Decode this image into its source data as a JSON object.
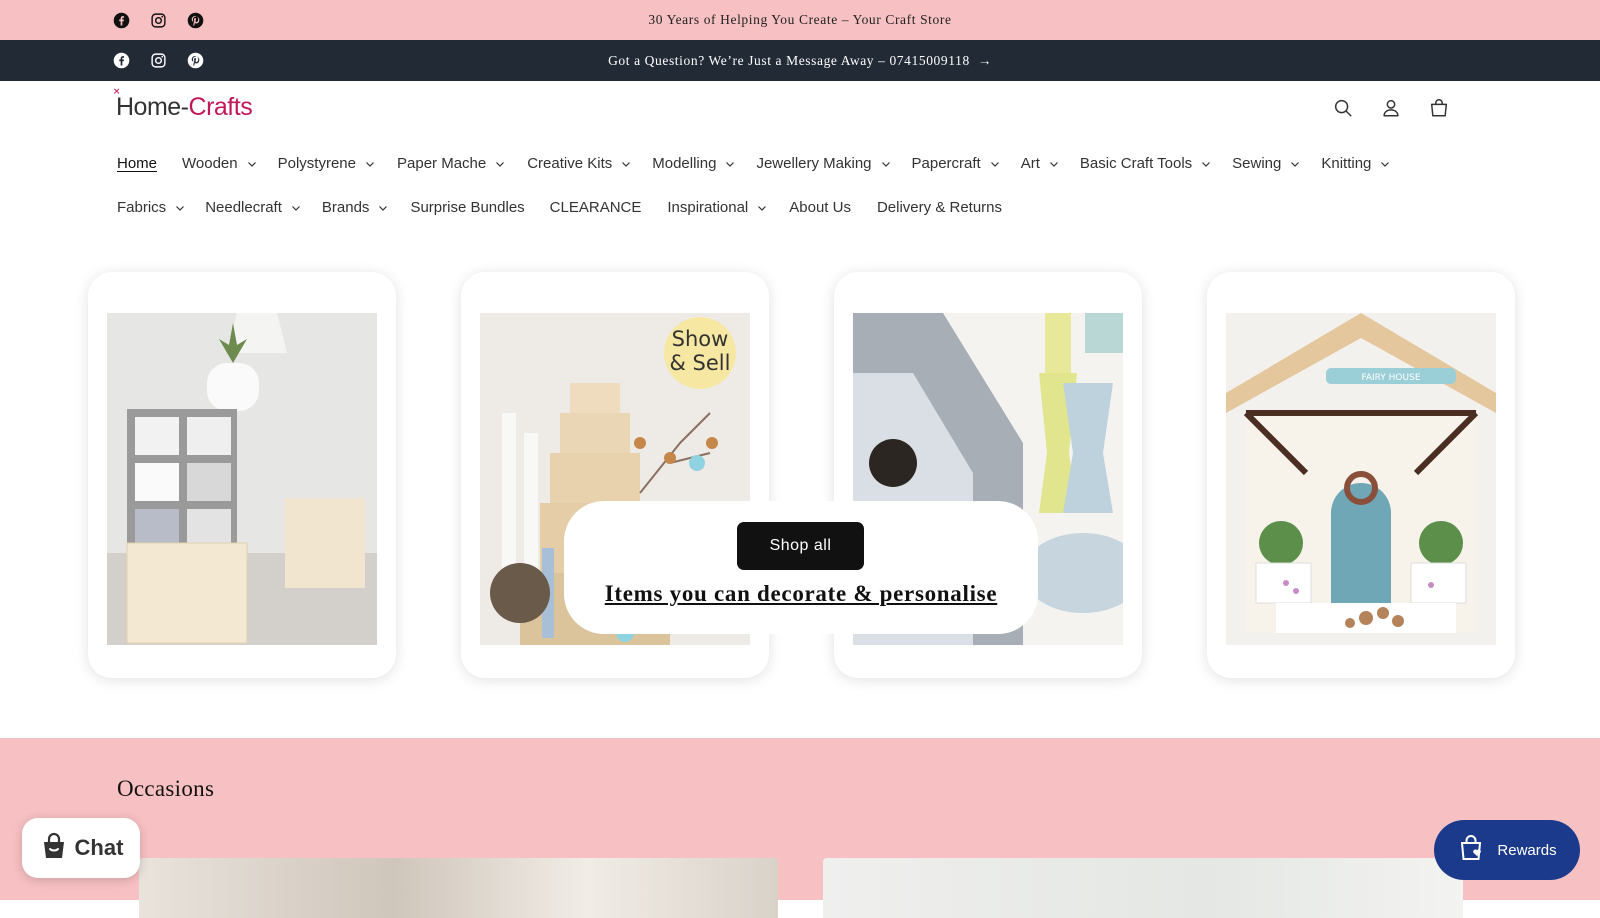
{
  "topbar": {
    "announcement": "30 Years of Helping You Create – Your Craft Store"
  },
  "subbar": {
    "announcement": "Got a Question? We’re Just a Message Away – 07415009118",
    "arrow": "→"
  },
  "socials": [
    "facebook-icon",
    "instagram-icon",
    "pinterest-icon"
  ],
  "header": {
    "logo_home": "Home-",
    "logo_crafts": "Crafts",
    "icons": [
      "search-icon",
      "account-icon",
      "cart-icon"
    ]
  },
  "nav": {
    "row1": [
      {
        "label": "Home",
        "active": true,
        "dropdown": false
      },
      {
        "label": "Wooden",
        "dropdown": true
      },
      {
        "label": "Polystyrene",
        "dropdown": true
      },
      {
        "label": "Paper Mache",
        "dropdown": true
      },
      {
        "label": "Creative Kits",
        "dropdown": true
      },
      {
        "label": "Modelling",
        "dropdown": true
      },
      {
        "label": "Jewellery Making",
        "dropdown": true
      },
      {
        "label": "Papercraft",
        "dropdown": true
      },
      {
        "label": "Art",
        "dropdown": true
      },
      {
        "label": "Basic Craft Tools",
        "dropdown": true
      },
      {
        "label": "Sewing",
        "dropdown": true
      },
      {
        "label": "Knitting",
        "dropdown": true
      }
    ],
    "row2": [
      {
        "label": "Fabrics",
        "dropdown": true
      },
      {
        "label": "Needlecraft",
        "dropdown": true
      },
      {
        "label": "Brands",
        "dropdown": true
      },
      {
        "label": "Surprise Bundles",
        "dropdown": false
      },
      {
        "label": "CLEARANCE",
        "dropdown": false
      },
      {
        "label": "Inspirational",
        "dropdown": true
      },
      {
        "label": "About Us",
        "dropdown": false
      },
      {
        "label": "Delivery & Returns",
        "dropdown": false
      }
    ]
  },
  "hero": {
    "shop_button": "Shop all",
    "title": "Items you can decorate & personalise",
    "show_sell_badge": "Show & Sell",
    "fairy_sign": "FAIRY HOUSE"
  },
  "occasions": {
    "title": "Occasions"
  },
  "chat": {
    "label": "Chat"
  },
  "rewards": {
    "label": "Rewards"
  },
  "colors": {
    "pink": "#f7c0c2",
    "navy": "#222a36",
    "rewards": "#1c3a8c",
    "brand": "#c2185b"
  }
}
